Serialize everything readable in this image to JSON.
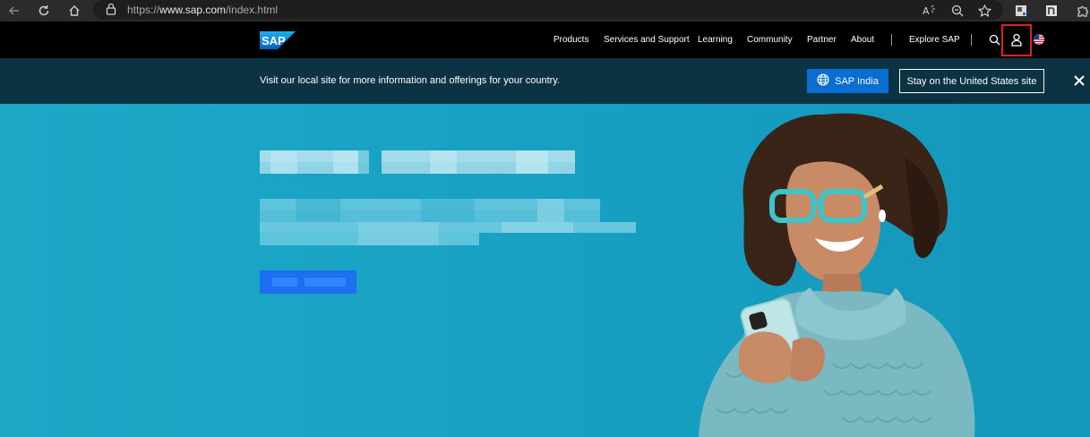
{
  "browser": {
    "url_prefix": "https://",
    "url_domain": "www.sap.com",
    "url_path": "/index.html"
  },
  "header": {
    "logo_text": "SAP",
    "nav": [
      "Products",
      "Services and Support",
      "Learning",
      "Community",
      "Partner",
      "About"
    ],
    "explore_label": "Explore SAP"
  },
  "banner": {
    "message": "Visit our local site for more information and offerings for your country.",
    "local_button": "SAP India",
    "stay_button": "Stay on the United States site"
  },
  "colors": {
    "header_bg": "#000000",
    "banner_bg": "#0c3344",
    "primary_button": "#0a6ed1",
    "hero_bg": "#1aa3c4",
    "highlight": "#e02020"
  }
}
